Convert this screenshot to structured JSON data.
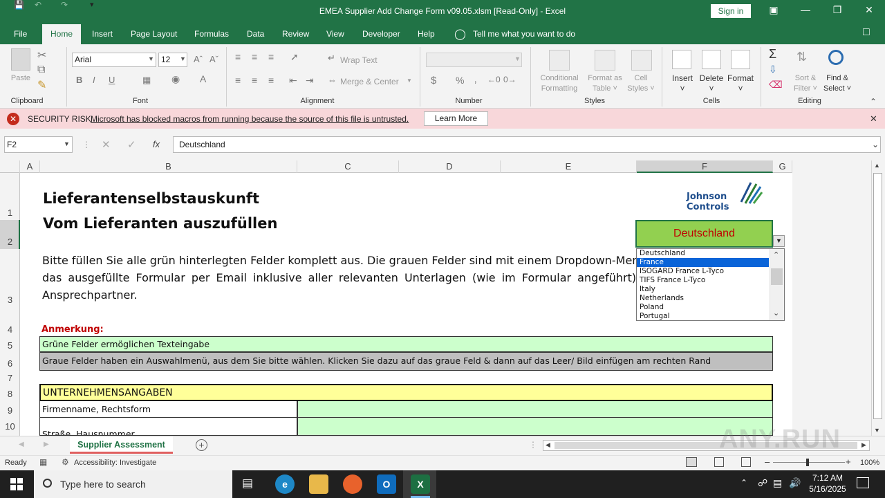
{
  "window": {
    "title": "EMEA Supplier Add Change Form v09.05.xlsm  [Read-Only]  -  Excel",
    "signin": "Sign in"
  },
  "tabs": [
    "File",
    "Home",
    "Insert",
    "Page Layout",
    "Formulas",
    "Data",
    "Review",
    "View",
    "Developer",
    "Help"
  ],
  "tellme": "Tell me what you want to do",
  "ribbon": {
    "clipboard": {
      "paste": "Paste",
      "label": "Clipboard"
    },
    "font": {
      "name": "Arial",
      "size": "12",
      "label": "Font"
    },
    "alignment": {
      "wrap": "Wrap Text",
      "merge": "Merge & Center",
      "label": "Alignment"
    },
    "number": {
      "label": "Number"
    },
    "styles": {
      "cond1": "Conditional",
      "cond2": "Formatting",
      "fmt1": "Format as",
      "fmt2": "Table",
      "cell1": "Cell",
      "cell2": "Styles",
      "label": "Styles"
    },
    "cells": {
      "insert": "Insert",
      "delete": "Delete",
      "format": "Format",
      "label": "Cells"
    },
    "editing": {
      "sort1": "Sort &",
      "sort2": "Filter",
      "find1": "Find &",
      "find2": "Select",
      "label": "Editing"
    }
  },
  "security": {
    "title": "SECURITY RISK",
    "message": "Microsoft has blocked macros from running because the source of this file is untrusted.",
    "button": "Learn More"
  },
  "formula_bar": {
    "name_box": "F2",
    "value": "Deutschland"
  },
  "columns": [
    "A",
    "B",
    "C",
    "D",
    "E",
    "F",
    "G"
  ],
  "rows": [
    "1",
    "2",
    "3",
    "4",
    "5",
    "6",
    "7",
    "8",
    "9",
    "10"
  ],
  "sheet": {
    "title1": "Lieferantenselbstauskunft",
    "title2": "Vom Lieferanten auszufüllen",
    "logo1": "Johnson",
    "logo2": "Controls",
    "intro1": "Bitte füllen Sie alle grün hinterlegten Felder komplett aus. Die grauen Felder sind mit einem Dropdown-Menü h",
    "intro2": "das ausgefüllte Formular per Email inklusive aller relevanten Unterlagen (wie im Formular angeführt) an",
    "intro3": "Ansprechpartner.",
    "note_label": "Anmerkung:",
    "note_green": "Grüne Felder ermöglichen Texteingabe",
    "note_gray": "Graue Felder haben ein Auswahlmenü, aus dem Sie bitte wählen. Klicken Sie dazu auf das graue Feld & dann auf das Leer/ Bild einfügen am rechten Rand",
    "section": "UNTERNEHMENSANGABEN",
    "row9": "Firmenname, Rechtsform",
    "row10": "Straße, Hausnummer"
  },
  "dropdown": {
    "selected": "Deutschland",
    "options": [
      "Deutschland",
      "France",
      "ISOGARD France L-Tyco",
      "TIFS France L-Tyco",
      "Italy",
      "Netherlands",
      "Poland",
      "Portugal"
    ],
    "highlighted": "France"
  },
  "sheet_tab": "Supplier Assessment",
  "status": {
    "ready": "Ready",
    "accessibility": "Accessibility: Investigate",
    "zoom": "100%"
  },
  "taskbar": {
    "search": "Type here to search",
    "time": "7:12 AM",
    "date": "5/16/2025"
  },
  "watermark": "ANY.RUN",
  "colors": {
    "excel_green": "#217346",
    "field_green": "#ccffcc",
    "field_gray": "#bfbfbf",
    "dropdown_green": "#92d050",
    "security_pink": "#f8d7da"
  }
}
